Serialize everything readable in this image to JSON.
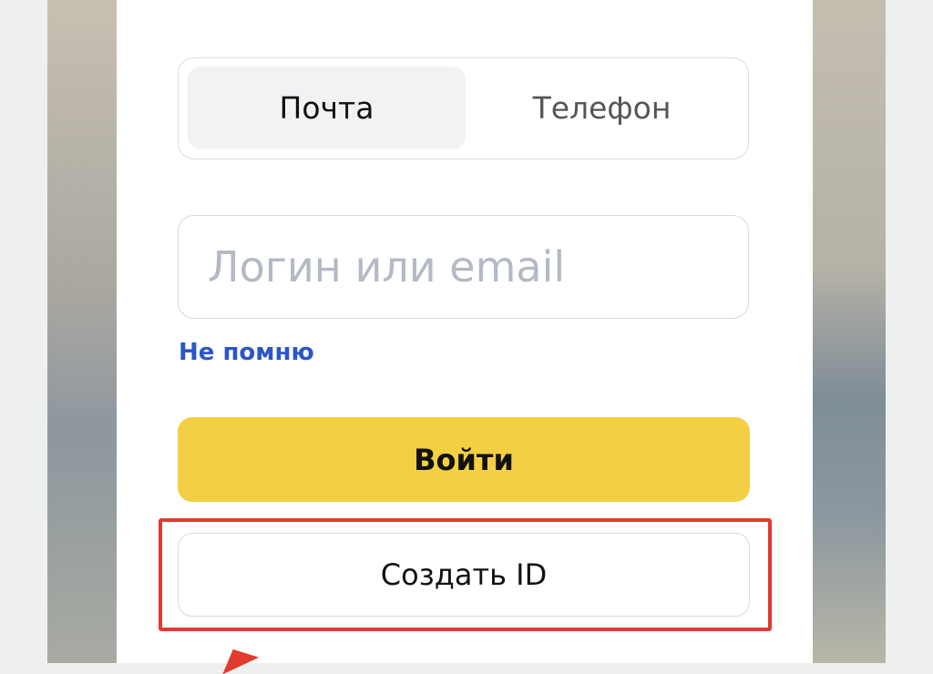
{
  "auth": {
    "tabs": [
      {
        "label": "Почта",
        "active": true
      },
      {
        "label": "Телефон",
        "active": false
      }
    ],
    "login_placeholder": "Логин или email",
    "forgot_label": "Не помню",
    "login_button": "Войти",
    "create_button": "Создать ID"
  },
  "colors": {
    "primary_button": "#f3d043",
    "link": "#2a57c4",
    "highlight": "#e23b2e"
  }
}
